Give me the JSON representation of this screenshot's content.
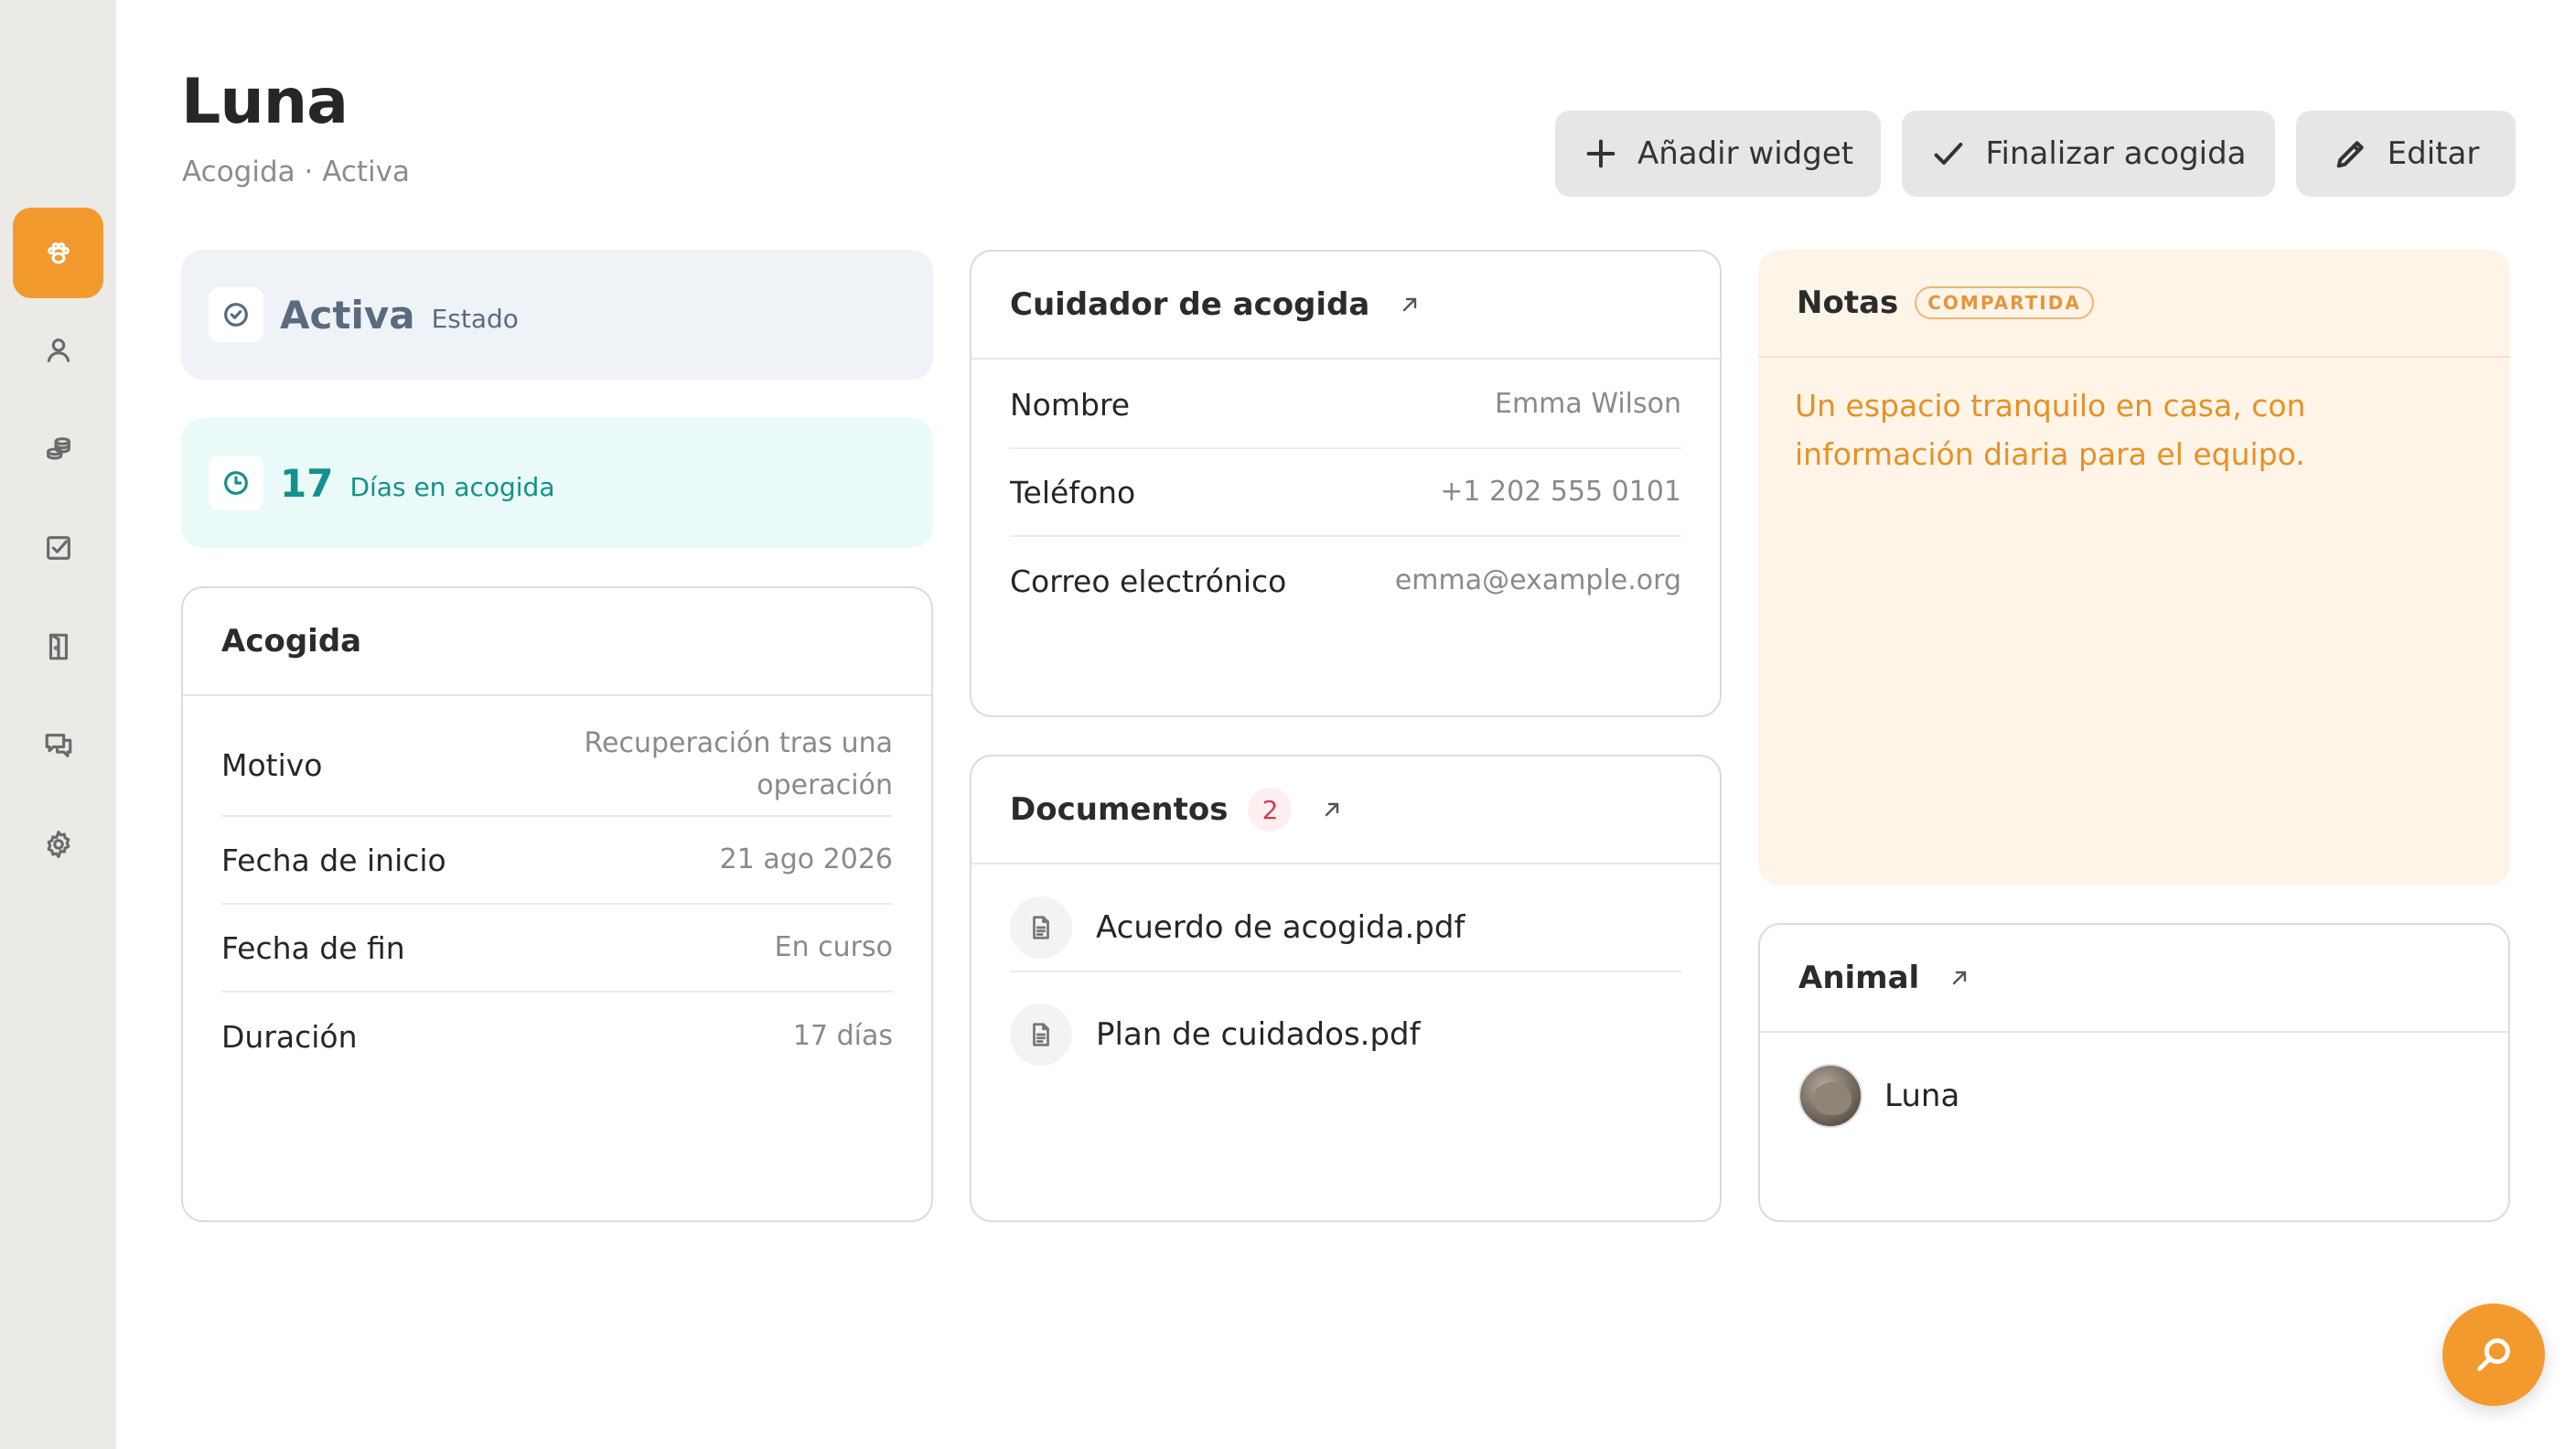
{
  "header": {
    "title": "Luna",
    "subtitle": "Acogida · Activa",
    "buttons": {
      "add_widget": "Añadir widget",
      "finish": "Finalizar acogida",
      "edit": "Editar"
    }
  },
  "sidebar": {
    "items": [
      {
        "icon": "paw-icon",
        "active": true
      },
      {
        "icon": "user-icon"
      },
      {
        "icon": "coins-icon"
      },
      {
        "icon": "checkbox-icon"
      },
      {
        "icon": "door-icon"
      },
      {
        "icon": "chat-icon"
      },
      {
        "icon": "gear-icon"
      }
    ]
  },
  "status": {
    "value": "Activa",
    "label": "Estado"
  },
  "days": {
    "value": "17",
    "label": "Días en acogida"
  },
  "foster": {
    "title": "Acogida",
    "rows": [
      {
        "label": "Motivo",
        "value_line1": "Recuperación tras una",
        "value_line2": "operación"
      },
      {
        "label": "Fecha de inicio",
        "value": "21 ago 2026"
      },
      {
        "label": "Fecha de fin",
        "value": "En curso"
      },
      {
        "label": "Duración",
        "value": "17 días"
      }
    ]
  },
  "caregiver": {
    "title": "Cuidador de acogida",
    "rows": [
      {
        "label": "Nombre",
        "value": "Emma Wilson"
      },
      {
        "label": "Teléfono",
        "value": "+1 202 555 0101"
      },
      {
        "label": "Correo electrónico",
        "value": "emma@example.org"
      }
    ]
  },
  "documents": {
    "title": "Documentos",
    "count": "2",
    "items": [
      {
        "name": "Acuerdo de acogida.pdf"
      },
      {
        "name": "Plan de cuidados.pdf"
      }
    ]
  },
  "notes": {
    "title": "Notas",
    "badge": "COMPARTIDA",
    "text": "Un espacio tranquilo en casa, con información diaria para el equipo."
  },
  "animal": {
    "title": "Animal",
    "name": "Luna"
  },
  "colors": {
    "accent": "#f29a2e",
    "status_text": "#5a6b80",
    "days_text": "#14918a",
    "notes_text": "#e69127",
    "doc_badge": "#d43a52"
  }
}
